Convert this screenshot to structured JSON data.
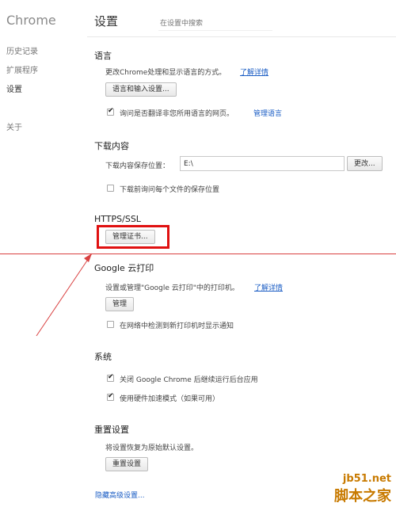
{
  "app": {
    "title": "Chrome"
  },
  "sidebar": {
    "items": [
      {
        "label": "历史记录"
      },
      {
        "label": "扩展程序"
      },
      {
        "label": "设置"
      },
      {
        "label": "关于"
      }
    ]
  },
  "page": {
    "title": "设置",
    "search_placeholder": "在设置中搜索"
  },
  "language": {
    "title": "语言",
    "desc": "更改Chrome处理和显示语言的方式。",
    "learn_more": "了解详情",
    "button": "语言和输入设置...",
    "translate_label": "询问是否翻译非您所用语言的网页。",
    "manage_link": "管理语言"
  },
  "downloads": {
    "title": "下载内容",
    "location_label": "下载内容保存位置：",
    "location_value": "E:\\",
    "change_button": "更改...",
    "ask_label": "下载前询问每个文件的保存位置"
  },
  "https": {
    "title": "HTTPS/SSL",
    "button": "管理证书..."
  },
  "cloud_print": {
    "title": "Google 云打印",
    "desc": "设置或管理\"Google 云打印\"中的打印机。",
    "learn_more": "了解详情",
    "button": "管理",
    "notify_label": "在网络中检测到新打印机时显示通知"
  },
  "system": {
    "title": "系统",
    "background_label": "关闭 Google Chrome 后继续运行后台应用",
    "hw_label": "使用硬件加速模式（如果可用）"
  },
  "reset": {
    "title": "重置设置",
    "desc": "将设置恢复为原始默认设置。",
    "button": "重置设置"
  },
  "advanced_link": "隐藏高级设置...",
  "watermark": {
    "line1": "jb51.net",
    "line2": "脚本之家"
  }
}
